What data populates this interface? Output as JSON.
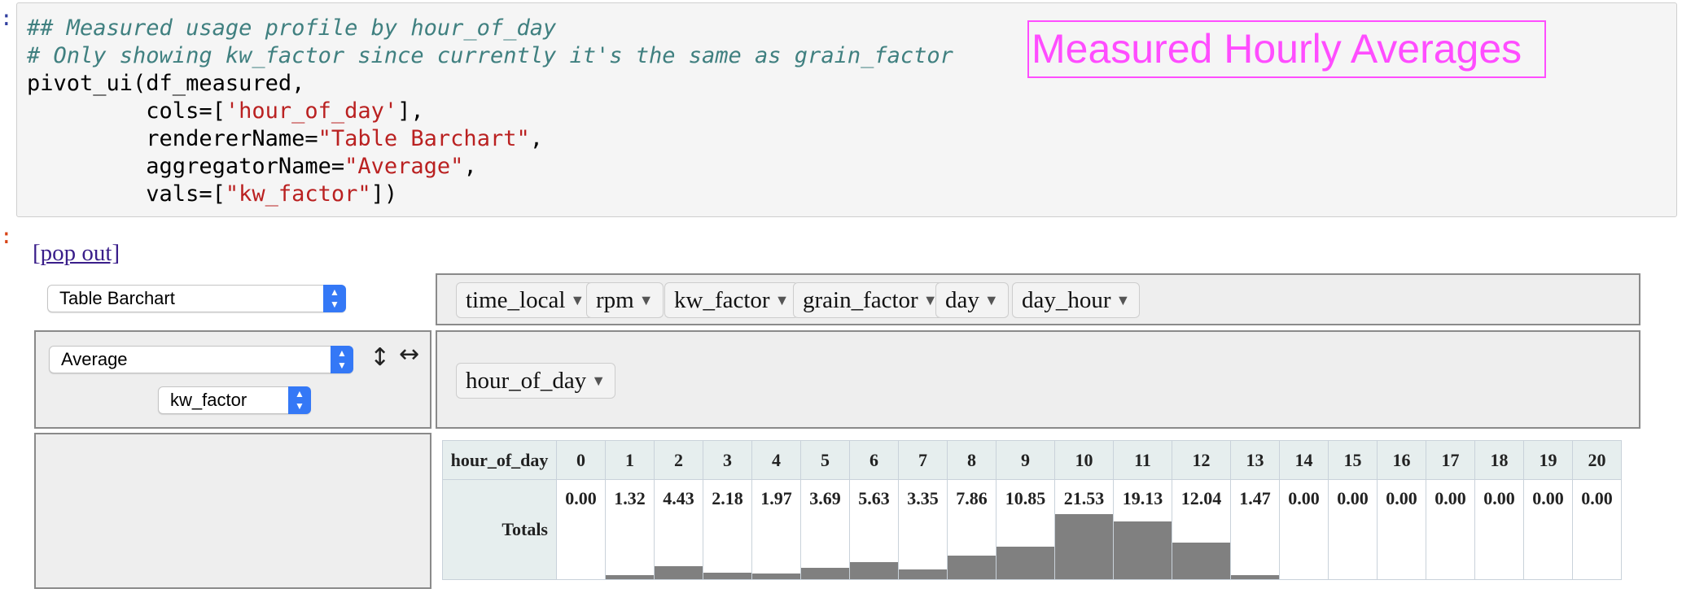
{
  "prompt_marks": [
    ":",
    ":"
  ],
  "code": {
    "line1": "## Measured usage profile by hour_of_day",
    "line2": "# Only showing kw_factor since currently it's the same as grain_factor",
    "line3": "pivot_ui(df_measured,",
    "line4_pre": "         cols=[",
    "line4_str": "'hour_of_day'",
    "line4_post": "],",
    "line5_pre": "         rendererName=",
    "line5_str": "\"Table Barchart\"",
    "line5_post": ",",
    "line6_pre": "         aggregatorName=",
    "line6_str": "\"Average\"",
    "line6_post": ",",
    "line7_pre": "         vals=[",
    "line7_str": "\"kw_factor\"",
    "line7_post": "])"
  },
  "annotation": "Measured Hourly Averages",
  "popout_link": "[pop out]",
  "renderer_select": "Table Barchart",
  "aggregator_select": "Average",
  "value_select": "kw_factor",
  "icons": {
    "row_order": "↕",
    "col_order": "↔",
    "dropdown": "caret-down-icon"
  },
  "unused_attributes": [
    "time_local",
    "rpm",
    "kw_factor",
    "grain_factor",
    "day",
    "day_hour"
  ],
  "column_attributes": [
    "hour_of_day"
  ],
  "table": {
    "header_label": "hour_of_day",
    "totals_label": "Totals",
    "hours": [
      "0",
      "1",
      "2",
      "3",
      "4",
      "5",
      "6",
      "7",
      "8",
      "9",
      "10",
      "11",
      "12",
      "13",
      "14",
      "15",
      "16",
      "17",
      "18",
      "19",
      "20"
    ],
    "values": [
      0.0,
      1.32,
      4.43,
      2.18,
      1.97,
      3.69,
      5.63,
      3.35,
      7.86,
      10.85,
      21.53,
      19.13,
      12.04,
      1.47,
      0.0,
      0.0,
      0.0,
      0.0,
      0.0,
      0.0,
      0.0
    ],
    "value_labels": [
      "0.00",
      "1.32",
      "4.43",
      "2.18",
      "1.97",
      "3.69",
      "5.63",
      "3.35",
      "7.86",
      "10.85",
      "21.53",
      "19.13",
      "12.04",
      "1.47",
      "0.00",
      "0.00",
      "0.00",
      "0.00",
      "0.00",
      "0.00",
      "0.00"
    ],
    "bar_color": "#808080"
  }
}
